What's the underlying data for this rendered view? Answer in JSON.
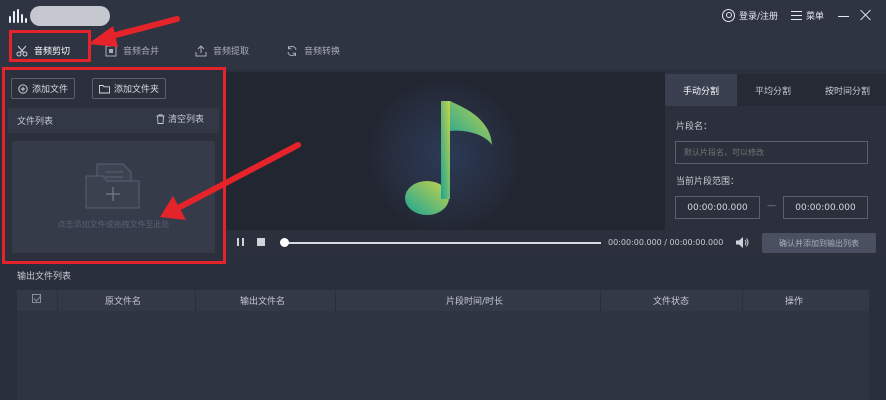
{
  "header": {
    "login_label": "登录/注册",
    "menu_label": "菜单"
  },
  "toolbar": {
    "tabs": [
      {
        "label": "音频剪切",
        "icon": "scissors-icon"
      },
      {
        "label": "音频合并",
        "icon": "merge-icon"
      },
      {
        "label": "音频提取",
        "icon": "extract-icon"
      },
      {
        "label": "音频转换",
        "icon": "convert-icon"
      }
    ],
    "active_tab": "音频剪切"
  },
  "file_panel": {
    "add_file_label": "添加文件",
    "add_folder_label": "添加文件夹",
    "list_title": "文件列表",
    "clear_label": "清空列表",
    "drop_hint": "点击添加文件或拖拽文件至此处"
  },
  "player": {
    "time_current": "00:00:00.000",
    "time_separator": "/",
    "time_total": "00:00:00.000",
    "progress": 0,
    "confirm_label": "确认并添加到输出列表"
  },
  "split_panel": {
    "tabs": [
      "手动分割",
      "平均分割",
      "按时间分割"
    ],
    "active_tab": "手动分割",
    "segment_name_label": "片段名：",
    "segment_name_placeholder": "默认片段名，可以修改",
    "range_label": "当前片段范围：",
    "range_start": "00:00:00.000",
    "range_dash": "—",
    "range_end": "00:00:00.000"
  },
  "output": {
    "title": "输出文件列表",
    "columns": [
      "原文件名",
      "输出文件名",
      "片段时间/时长",
      "文件状态",
      "操作"
    ],
    "rows": []
  },
  "colors": {
    "annotation_red": "#e5232a",
    "note_gradient_start": "#1aa595",
    "note_gradient_end": "#c8d34a",
    "background": "#2a2f3c"
  }
}
